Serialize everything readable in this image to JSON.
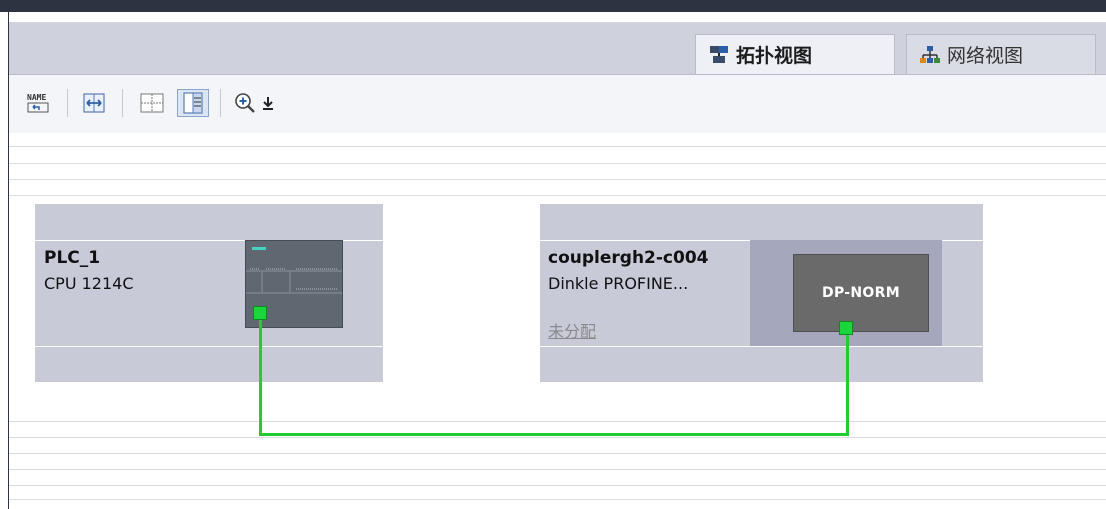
{
  "tabs": [
    {
      "label": "拓扑视图",
      "icon": "topology-view-icon",
      "active": true
    },
    {
      "label": "网络视图",
      "icon": "network-view-icon",
      "active": false
    }
  ],
  "toolbar": {
    "items": [
      {
        "icon": "name-assign-icon",
        "label": "NAME"
      },
      {
        "icon": "fit-width-icon"
      },
      {
        "icon": "grid-layout-icon"
      },
      {
        "icon": "overview-table-icon",
        "selected": true
      },
      {
        "icon": "zoom-in-icon"
      },
      {
        "icon": "dropdown-arrow-icon"
      }
    ]
  },
  "devices": [
    {
      "name": "PLC_1",
      "type": "CPU 1214C",
      "image": "plc-cpu-module"
    },
    {
      "name": "couplergh2-c004",
      "type": "Dinkle PROFINE...",
      "status": "未分配",
      "image_label": "DP-NORM"
    }
  ],
  "connection": {
    "color": "#22cc33",
    "from": "PLC_1",
    "to": "couplergh2-c004"
  },
  "colors": {
    "port_green": "#1ad63a",
    "device_bg": "#c8cad8",
    "dp_module": "#6a6a6a"
  }
}
